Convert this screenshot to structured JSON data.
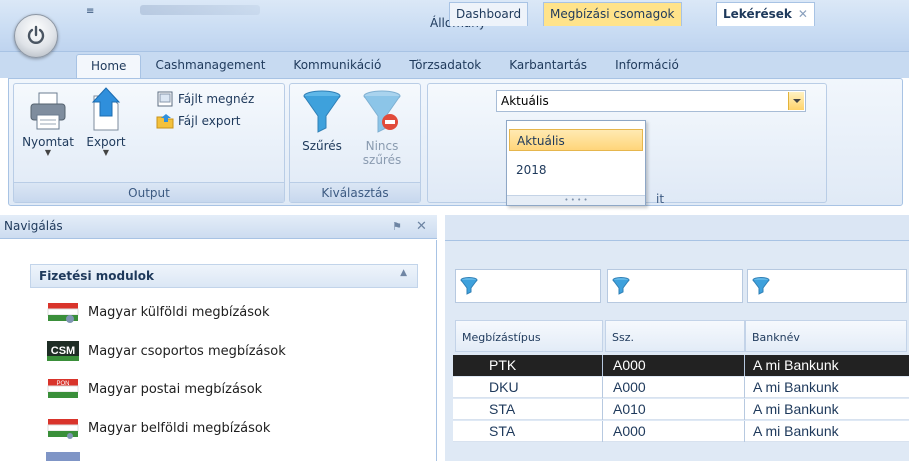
{
  "app": {
    "quick_access": "≡"
  },
  "ribbon_tabs": [
    "Home",
    "Cashmanagement",
    "Kommunikáció",
    "Törzsadatok",
    "Karbantartás",
    "Információ"
  ],
  "output_group": {
    "label": "Output",
    "print_label": "Nyomtat",
    "export_label": "Export",
    "file_view_label": "Fájlt megnéz",
    "file_export_label": "Fájl export"
  },
  "selection_group": {
    "label": "Kiválasztás",
    "filter_label": "Szűrés",
    "no_filter_line1": "Nincs",
    "no_filter_line2": "szűrés"
  },
  "file_group": {
    "field_label": "Állomány",
    "selected_value": "Aktuális",
    "label_tail": "it",
    "dropdown_options": [
      "Aktuális",
      "2018"
    ]
  },
  "navigation": {
    "title": "Navigálás",
    "pin_glyph": "⚑",
    "close_glyph": "✕",
    "group_title": "Fizetési modulok",
    "items": [
      "Magyar külföldi megbízások",
      "Magyar csoportos megbízások",
      "Magyar postai megbízások",
      "Magyar belföldi megbízások"
    ],
    "badges": [
      "CSM",
      "PON"
    ]
  },
  "doc_tabs": [
    "Dashboard",
    "Megbízási csomagok",
    "Lekérések"
  ],
  "grid": {
    "columns": [
      "Megbízástípus",
      "Ssz.",
      "Banknév"
    ],
    "rows": [
      [
        "PTK",
        "A000",
        "A mi Bankunk"
      ],
      [
        "DKU",
        "A000",
        "A mi Bankunk"
      ],
      [
        "STA",
        "A010",
        "A mi Bankunk"
      ],
      [
        "STA",
        "A000",
        "A mi Bankunk"
      ]
    ],
    "selected_row": 0
  },
  "colors": {
    "accent_yellow": "#ffd57a",
    "ribbon_blue": "#c7daf1",
    "selected_row": "#222222"
  }
}
